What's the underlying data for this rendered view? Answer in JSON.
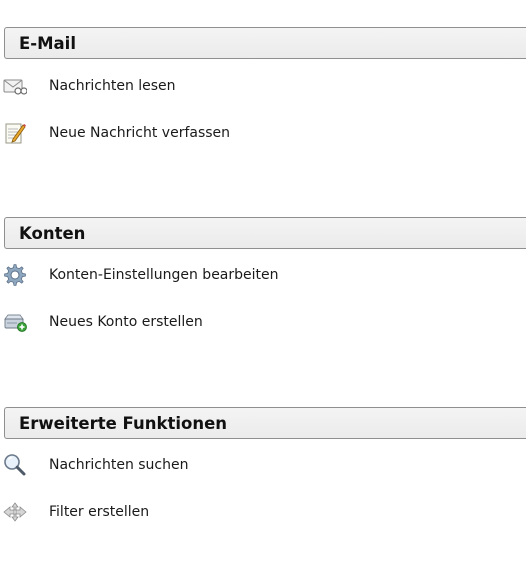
{
  "sections": [
    {
      "title": "E-Mail",
      "items": [
        {
          "label": "Nachrichten lesen",
          "icon": "envelope-read-icon"
        },
        {
          "label": "Neue Nachricht verfassen",
          "icon": "compose-note-icon"
        }
      ]
    },
    {
      "title": "Konten",
      "items": [
        {
          "label": "Konten-Einstellungen bearbeiten",
          "icon": "gear-icon"
        },
        {
          "label": "Neues Konto erstellen",
          "icon": "add-account-icon"
        }
      ]
    },
    {
      "title": "Erweiterte Funktionen",
      "items": [
        {
          "label": "Nachrichten suchen",
          "icon": "search-icon"
        },
        {
          "label": "Filter erstellen",
          "icon": "filter-icon"
        }
      ]
    }
  ]
}
